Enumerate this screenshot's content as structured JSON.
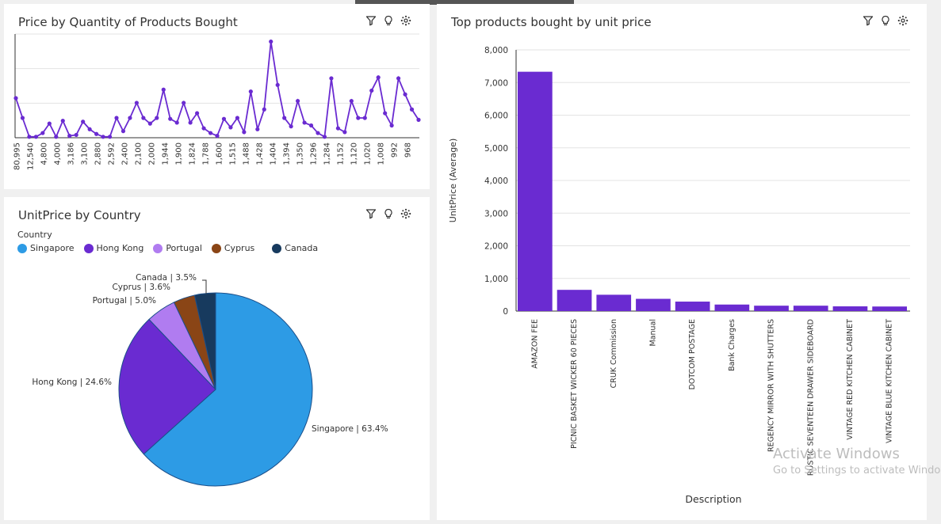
{
  "panels": {
    "line": {
      "title": "Price by Quantity of Products Bought"
    },
    "pie": {
      "title": "UnitPrice by Country"
    },
    "bar": {
      "title": "Top products bought by unit price"
    }
  },
  "legend": {
    "title": "Country",
    "items": [
      {
        "label": "Singapore",
        "color": "#2d9be5"
      },
      {
        "label": "Hong Kong",
        "color": "#6a2bd1"
      },
      {
        "label": "Portugal",
        "color": "#b07cf0"
      },
      {
        "label": "Cyprus",
        "color": "#8a4516"
      },
      {
        "label": "Canada",
        "color": "#173a5e"
      }
    ]
  },
  "watermark": {
    "line1": "Activate Windows",
    "line2": "Go to Settings to activate Windows."
  },
  "chart_data": [
    {
      "type": "line",
      "title": "Price by Quantity of Products Bought",
      "tick_labels": [
        "80,995",
        "12,540",
        "4,800",
        "4,000",
        "3,186",
        "3,100",
        "2,880",
        "2,592",
        "2,400",
        "2,100",
        "2,000",
        "1,944",
        "1,900",
        "1,824",
        "1,788",
        "1,600",
        "1,515",
        "1,488",
        "1,428",
        "1,404",
        "1,394",
        "1,350",
        "1,296",
        "1,284",
        "1,152",
        "1,120",
        "1,020",
        "1,008",
        "992",
        "968"
      ],
      "values": [
        4.2,
        2.1,
        0.1,
        0.1,
        0.5,
        1.5,
        0.1,
        1.8,
        0.2,
        0.3,
        1.7,
        0.9,
        0.4,
        0.1,
        0.1,
        2.1,
        0.7,
        2.1,
        3.7,
        2.1,
        1.5,
        2.1,
        5.1,
        2.0,
        1.6,
        3.7,
        1.6,
        2.6,
        1.0,
        0.5,
        0.2,
        2.0,
        1.1,
        2.1,
        0.6,
        4.9,
        0.9,
        3.0,
        10.2,
        5.6,
        2.1,
        1.2,
        3.9,
        1.6,
        1.3,
        0.5,
        0.1,
        6.3,
        1.0,
        0.6,
        3.9,
        2.1,
        2.1,
        5.0,
        6.4,
        2.6,
        1.3,
        6.3,
        4.6,
        3.0,
        1.9
      ],
      "color": "#6a2bd1",
      "grid": true
    },
    {
      "type": "pie",
      "title": "UnitPrice by Country",
      "legend_title": "Country",
      "slices": [
        {
          "label": "Singapore",
          "value": 63.4,
          "text": "Singapore | 63.4%",
          "color": "#2d9be5"
        },
        {
          "label": "Hong Kong",
          "value": 24.6,
          "text": "Hong Kong | 24.6%",
          "color": "#6a2bd1"
        },
        {
          "label": "Portugal",
          "value": 5.0,
          "text": "Portugal | 5.0%",
          "color": "#b07cf0"
        },
        {
          "label": "Cyprus",
          "value": 3.6,
          "text": "Cyprus | 3.6%",
          "color": "#8a4516"
        },
        {
          "label": "Canada",
          "value": 3.5,
          "text": "Canada | 3.5%",
          "color": "#173a5e"
        }
      ]
    },
    {
      "type": "bar",
      "title": "Top products bought by unit price",
      "categories": [
        "AMAZON FEE",
        "PICNIC BASKET WICKER 60 PIECES",
        "CRUK Commission",
        "Manual",
        "DOTCOM POSTAGE",
        "Bank Charges",
        "REGENCY MIRROR WITH SHUTTERS",
        "RUSTIC SEVENTEEN DRAWER SIDEBOARD",
        "VINTAGE RED KITCHEN CABINET",
        "VINTAGE BLUE KITCHEN CABINET"
      ],
      "values": [
        7330,
        650,
        500,
        375,
        290,
        200,
        165,
        165,
        145,
        140
      ],
      "xlabel": "Description",
      "ylabel": "UnitPrice (Average)",
      "ylim": [
        0,
        8000
      ],
      "yticks": [
        "0",
        "1,000",
        "2,000",
        "3,000",
        "4,000",
        "5,000",
        "6,000",
        "7,000",
        "8,000"
      ],
      "color": "#6a2bd1",
      "grid": true
    }
  ]
}
